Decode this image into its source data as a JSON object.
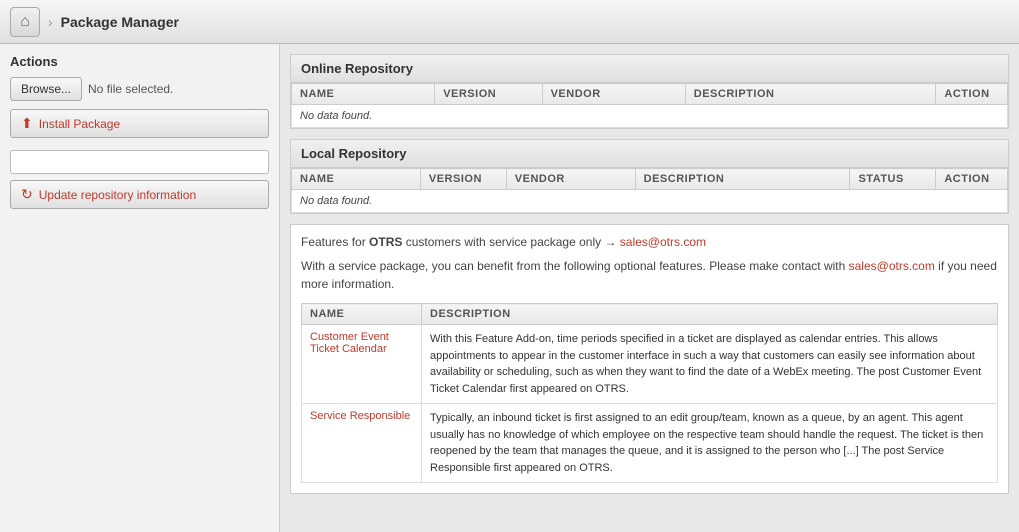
{
  "topbar": {
    "home_icon": "🏠",
    "breadcrumb_arrow": "›",
    "page_title": "Package Manager"
  },
  "sidebar": {
    "section_title": "Actions",
    "browse_label": "Browse...",
    "no_file_text": "No file selected.",
    "install_label": "Install Package",
    "repo_placeholder": "",
    "update_repo_label": "Update repository information"
  },
  "online_repo": {
    "section_title": "Online Repository",
    "columns": [
      "NAME",
      "VERSION",
      "VENDOR",
      "DESCRIPTION",
      "ACTION"
    ],
    "no_data": "No data found."
  },
  "local_repo": {
    "section_title": "Local Repository",
    "columns": [
      "NAME",
      "VERSION",
      "VENDOR",
      "DESCRIPTION",
      "STATUS",
      "ACTION"
    ],
    "no_data": "No data found."
  },
  "features": {
    "header_prefix": "Features for ",
    "otrs_label": "OTRS",
    "header_middle": " customers with service package only → ",
    "header_email": "sales@otrs.com",
    "description_before_link": "With a service package, you can benefit from the following optional features. Please make contact with ",
    "description_email": "sales@otrs.com",
    "description_after_link": " if you need more information.",
    "table_columns": [
      "NAME",
      "DESCRIPTION"
    ],
    "features": [
      {
        "name": "Customer Event Ticket Calendar",
        "link": "#",
        "description": "With this Feature Add-on, time periods specified in a ticket are displayed as calendar entries. This allows appointments to appear in the customer interface in such a way that customers can easily see information about availability or scheduling, such as when they want to find the date of a WebEx meeting. The post Customer Event Ticket Calendar first appeared on OTRS."
      },
      {
        "name": "Service Responsible",
        "link": "#",
        "description": "Typically, an inbound ticket is first assigned to an edit group/team, known as a queue, by an agent. This agent usually has no knowledge of which employee on the respective team should handle the request. The ticket is then reopened by the team that manages the queue, and it is assigned to the person who [...] The post Service Responsible first appeared on OTRS."
      }
    ]
  }
}
